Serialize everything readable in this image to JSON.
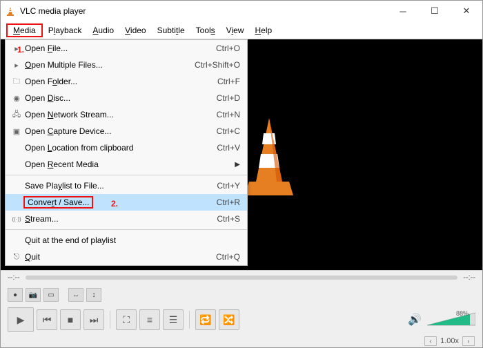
{
  "title": "VLC media player",
  "windowControls": {
    "minimize": "─",
    "maximize": "☐",
    "close": "✕"
  },
  "menubar": [
    {
      "pre": "",
      "ul": "M",
      "post": "edia"
    },
    {
      "pre": "P",
      "ul": "l",
      "post": "ayback"
    },
    {
      "pre": "",
      "ul": "A",
      "post": "udio"
    },
    {
      "pre": "",
      "ul": "V",
      "post": "ideo"
    },
    {
      "pre": "Subti",
      "ul": "t",
      "post": "le"
    },
    {
      "pre": "Tool",
      "ul": "s",
      "post": ""
    },
    {
      "pre": "V",
      "ul": "i",
      "post": "ew"
    },
    {
      "pre": "",
      "ul": "H",
      "post": "elp"
    }
  ],
  "annotations": {
    "one": "1.",
    "two": "2."
  },
  "dropdown": [
    {
      "icon": "▸",
      "pre": "Open ",
      "ul": "F",
      "post": "ile...",
      "shortcut": "Ctrl+O"
    },
    {
      "icon": "▸",
      "pre": "",
      "ul": "O",
      "post": "pen Multiple Files...",
      "shortcut": "Ctrl+Shift+O"
    },
    {
      "icon": "🗀",
      "pre": "Open F",
      "ul": "o",
      "post": "lder...",
      "shortcut": "Ctrl+F"
    },
    {
      "icon": "◉",
      "pre": "Open ",
      "ul": "D",
      "post": "isc...",
      "shortcut": "Ctrl+D"
    },
    {
      "icon": "🖧",
      "pre": "Open ",
      "ul": "N",
      "post": "etwork Stream...",
      "shortcut": "Ctrl+N"
    },
    {
      "icon": "▣",
      "pre": "Open ",
      "ul": "C",
      "post": "apture Device...",
      "shortcut": "Ctrl+C"
    },
    {
      "icon": "",
      "pre": "Open ",
      "ul": "L",
      "post": "ocation from clipboard",
      "shortcut": "Ctrl+V"
    },
    {
      "icon": "",
      "pre": "Open ",
      "ul": "R",
      "post": "ecent Media",
      "shortcut": "",
      "submenu": true
    },
    {
      "sep": true
    },
    {
      "icon": "",
      "pre": "Save Pla",
      "ul": "y",
      "post": "list to File...",
      "shortcut": "Ctrl+Y"
    },
    {
      "icon": "",
      "pre": "Conve",
      "ul": "r",
      "post": "t / Save...",
      "shortcut": "Ctrl+R",
      "highlight": true,
      "redbox": true
    },
    {
      "icon": "((·))",
      "pre": "",
      "ul": "S",
      "post": "tream...",
      "shortcut": "Ctrl+S"
    },
    {
      "sep": true
    },
    {
      "icon": "",
      "pre": "Quit at the end of playlist",
      "ul": "",
      "post": "",
      "shortcut": ""
    },
    {
      "icon": "⎋",
      "pre": "",
      "ul": "Q",
      "post": "uit",
      "shortcut": "Ctrl+Q"
    }
  ],
  "timeDisplay": {
    "left": "--:--",
    "right": "--:--"
  },
  "playbackSpeed": "1.00x",
  "volumeLabel": "88%",
  "toolbarIcons": {
    "record": "●",
    "snapshot": "📷",
    "box": "▭",
    "control1": "↔",
    "control2": "↕"
  },
  "controlIcons": {
    "play": "▶",
    "prev": "⏮",
    "stop": "■",
    "next": "⏭",
    "fullscreen": "⛶",
    "extended": "≡",
    "playlist": "☰",
    "loop": "🔁",
    "shuffle": "🔀"
  }
}
